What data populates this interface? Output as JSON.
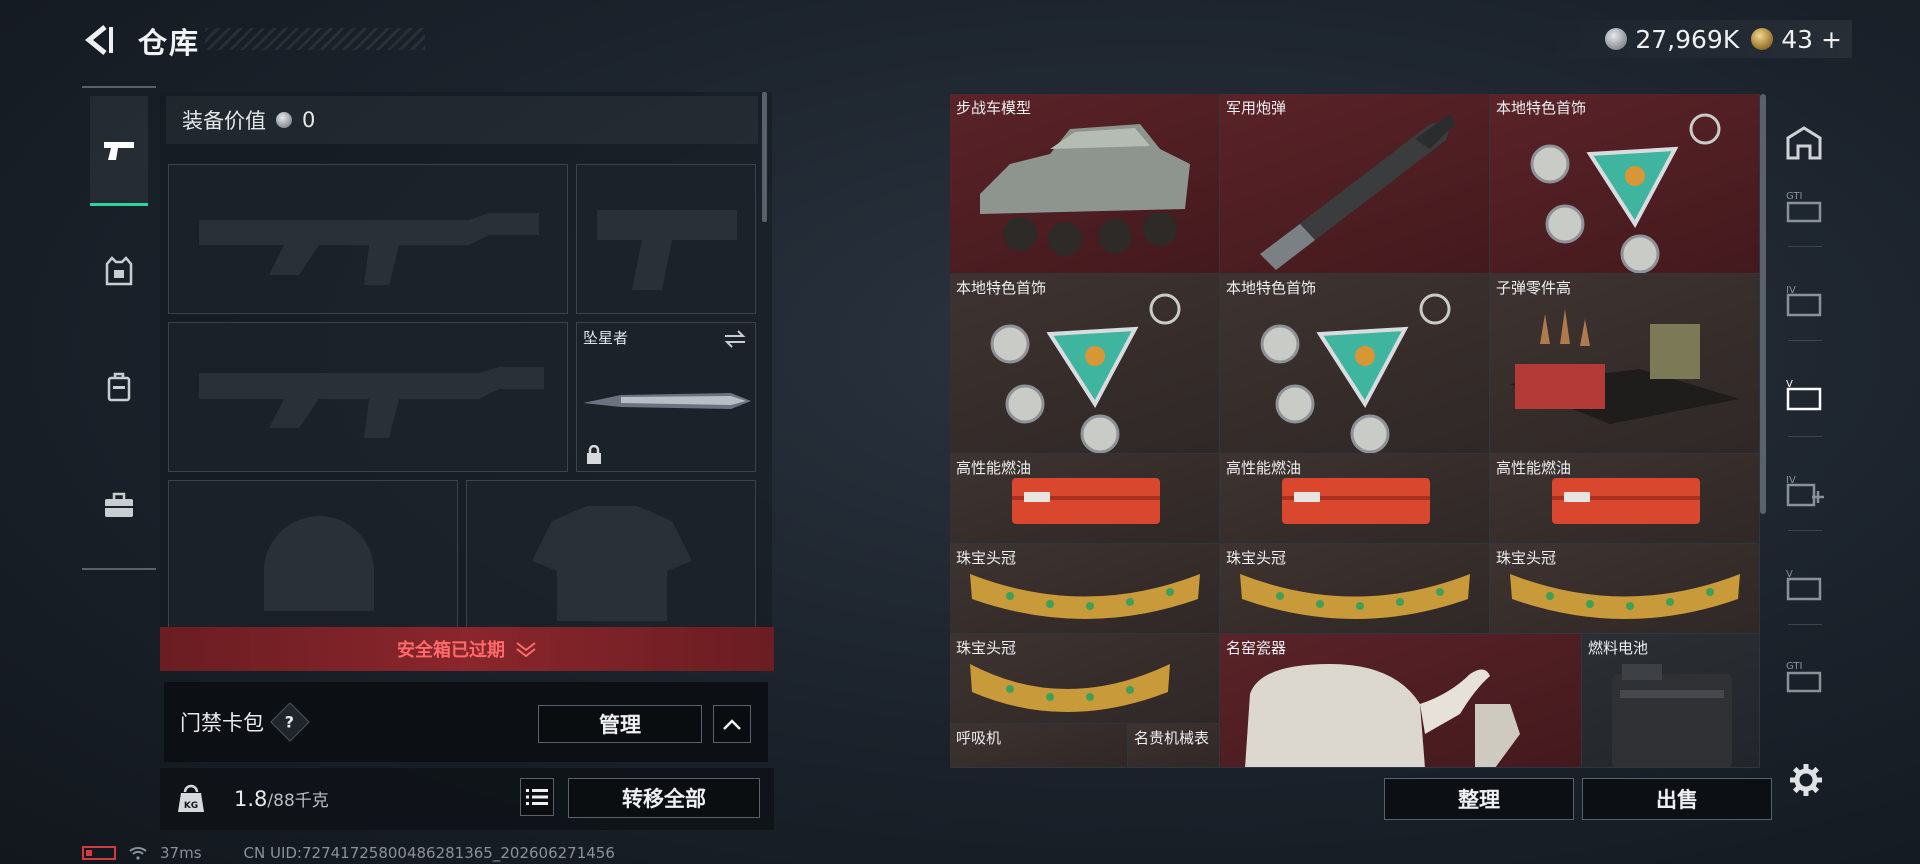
{
  "header": {
    "title": "仓库",
    "currency_silver": "27,969K",
    "currency_gold": "43",
    "add_symbol": "+"
  },
  "rail": {
    "tabs": [
      {
        "name": "weapons",
        "icon": "pistol-icon",
        "active": true
      },
      {
        "name": "rig",
        "icon": "vest-icon",
        "active": false
      },
      {
        "name": "backpack",
        "icon": "backpack-icon",
        "active": false
      },
      {
        "name": "case",
        "icon": "briefcase-icon",
        "active": false
      }
    ]
  },
  "loadout": {
    "value_label": "装备价值",
    "value": "0",
    "melee_label": "坠星者",
    "slots": [
      "primary-rifle",
      "pistol",
      "secondary-rifle",
      "melee",
      "helmet",
      "armor"
    ]
  },
  "safe_box": {
    "status": "安全箱已过期"
  },
  "keycard": {
    "label": "门禁卡包",
    "help": "?",
    "manage": "管理"
  },
  "weight": {
    "current": "1.8",
    "capacity": "/88千克"
  },
  "transfer_all": "转移全部",
  "status_bar": {
    "ping": "37ms",
    "uid": "CN UID:727417258004862813​65_202606271456"
  },
  "stash": {
    "items": [
      {
        "label": "步战车模型",
        "color": "red"
      },
      {
        "label": "军用炮弹",
        "color": "red"
      },
      {
        "label": "本地特色首饰",
        "color": "red"
      },
      {
        "label": "本地特色首饰",
        "color": "brown"
      },
      {
        "label": "本地特色首饰",
        "color": "brown"
      },
      {
        "label": "子弹零件高",
        "color": "brown"
      },
      {
        "label": "高性能燃油",
        "color": "brown"
      },
      {
        "label": "高性能燃油",
        "color": "brown"
      },
      {
        "label": "高性能燃油",
        "color": "brown"
      },
      {
        "label": "珠宝头冠",
        "color": "brown"
      },
      {
        "label": "珠宝头冠",
        "color": "brown"
      },
      {
        "label": "珠宝头冠",
        "color": "brown"
      },
      {
        "label": "珠宝头冠",
        "color": "brown"
      },
      {
        "label": "名窑瓷器",
        "color": "red"
      },
      {
        "label": "燃料电池",
        "color": "dark"
      },
      {
        "label": "呼吸机",
        "color": "brown"
      },
      {
        "label": "名贵机械表",
        "color": "brown"
      }
    ],
    "sort_button": "整理",
    "sell_button": "出售"
  },
  "tools": [
    "shelter-icon",
    "gti-card-icon",
    "iv-card-icon",
    "v-card-icon",
    "iv-add-icon",
    "v-card-alt-icon",
    "gti-alt-icon",
    "settings-icon"
  ],
  "colors": {
    "accent_green": "#31d49c",
    "alert_red": "#ff6a6a",
    "expired_bg": "#8a262c"
  }
}
